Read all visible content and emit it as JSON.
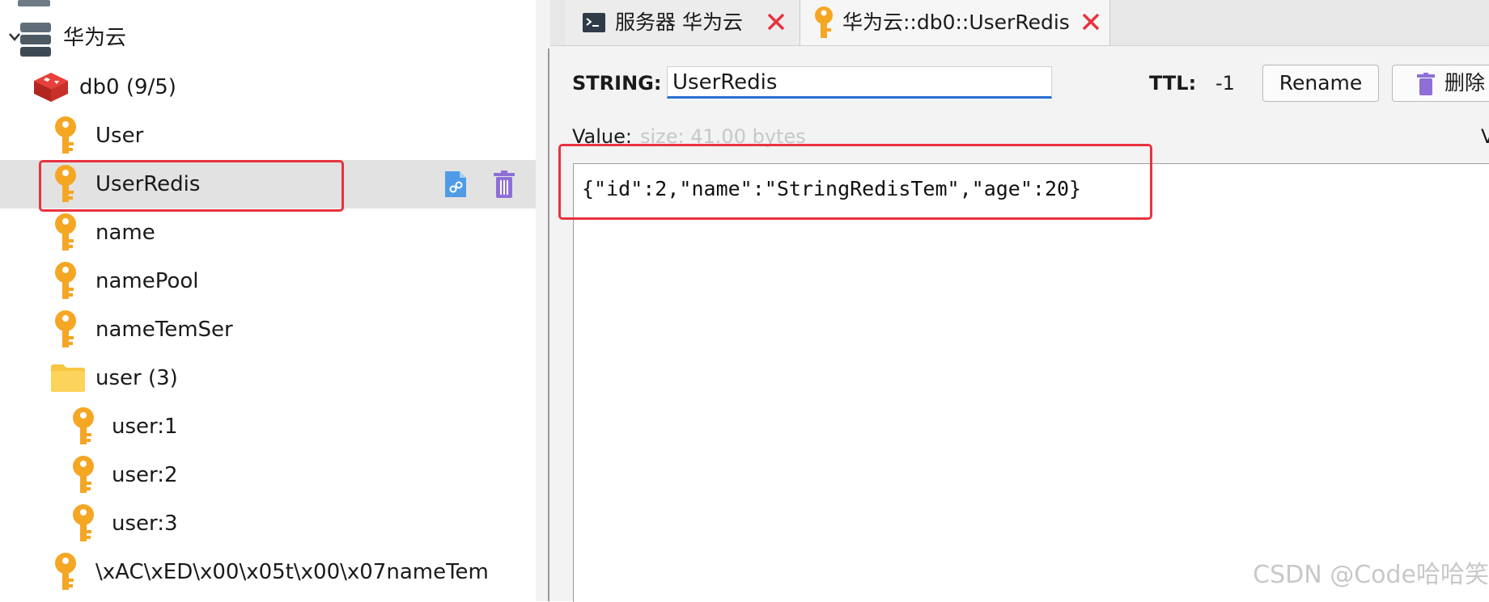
{
  "tree": {
    "server": {
      "label": "华为云",
      "expanded": true
    },
    "database": {
      "label": "db0  (9/5)"
    },
    "keys": [
      {
        "label": "User"
      },
      {
        "label": "UserRedis",
        "selected": true
      },
      {
        "label": "name"
      },
      {
        "label": "namePool"
      },
      {
        "label": "nameTemSer"
      }
    ],
    "folder": {
      "label": "user (3)",
      "items": [
        {
          "label": "user:1"
        },
        {
          "label": "user:2"
        },
        {
          "label": "user:3"
        }
      ]
    },
    "last_key": {
      "label": "\\xAC\\xED\\x00\\x05t\\x00\\x07nameTem"
    }
  },
  "tabs": [
    {
      "label": "服务器 华为云",
      "icon": "terminal-icon"
    },
    {
      "label": "华为云::db0::UserRedis",
      "icon": "key-icon",
      "active": true
    }
  ],
  "editor": {
    "type_label": "STRING:",
    "key_name": "UserRedis",
    "ttl_label": "TTL:",
    "ttl_value": "-1",
    "rename_label": "Rename",
    "delete_label": "删除",
    "value_label": "Value:",
    "size_label": "size: 41.00 bytes",
    "view_label_cut": "V",
    "value": "{\"id\":2,\"name\":\"StringRedisTem\",\"age\":20}"
  },
  "watermark": "CSDN @Code哈哈笑",
  "colors": {
    "highlight": "#e8333e",
    "key": "#f5a623",
    "db": "#d82c20",
    "folder": "#f9c642",
    "accent": "#2a6fd1"
  }
}
